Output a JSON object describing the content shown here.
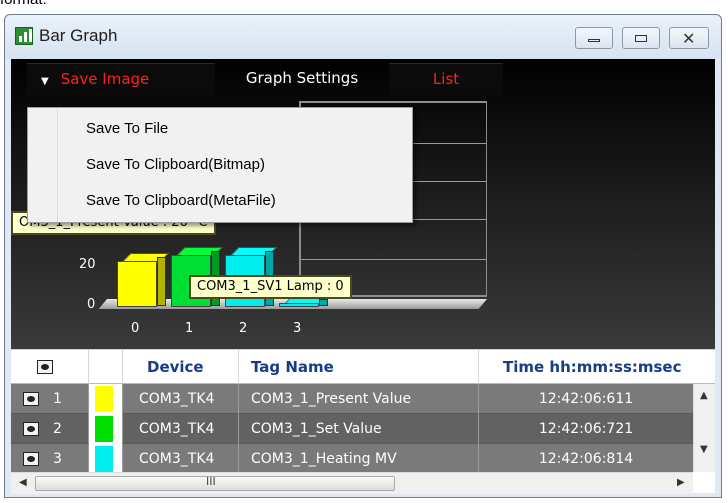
{
  "window": {
    "title": "Bar Graph",
    "top_strip_text": "format."
  },
  "tabs": {
    "save": "Save Image",
    "settings": "Graph Settings",
    "list": "List"
  },
  "menu": {
    "items": [
      "Save To File",
      "Save To Clipboard(Bitmap)",
      "Save To Clipboard(MetaFile)"
    ]
  },
  "tooltips": {
    "present": "OM3_1_Present Value : 26 °C",
    "lamp": "COM3_1_SV1 Lamp : 0"
  },
  "chart_data": {
    "type": "bar",
    "categories": [
      "0",
      "1",
      "2",
      "3"
    ],
    "values": [
      23,
      26,
      26,
      0
    ],
    "y_ticks": [
      "0",
      "20"
    ],
    "colors": [
      "#ffff00",
      "#00dd33",
      "#00eeee",
      "#00eeee"
    ]
  },
  "table": {
    "headers": {
      "icon": "eye-icon",
      "device": "Device",
      "tag": "Tag Name",
      "time": "Time hh:mm:ss:msec"
    },
    "rows": [
      {
        "num": "1",
        "color": "#ffff00",
        "device": "COM3_TK4",
        "tag": "COM3_1_Present Value",
        "time": "12:42:06:611"
      },
      {
        "num": "2",
        "color": "#00dd00",
        "device": "COM3_TK4",
        "tag": "COM3_1_Set Value",
        "time": "12:42:06:721"
      },
      {
        "num": "3",
        "color": "#00eeee",
        "device": "COM3_TK4",
        "tag": "COM3_1_Heating MV",
        "time": "12:42:06:814"
      }
    ],
    "scroll_thumb_label": "III"
  }
}
